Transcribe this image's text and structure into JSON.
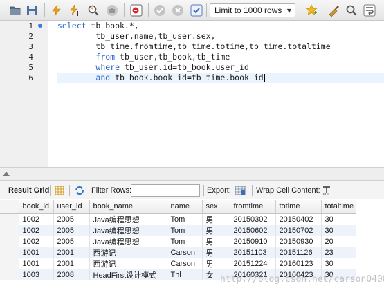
{
  "toolbar": {
    "buttons": [
      {
        "id": "open-folder",
        "icon": "folder-icon"
      },
      {
        "id": "save",
        "icon": "save-icon"
      },
      {
        "id": "execute",
        "icon": "lightning-icon"
      },
      {
        "id": "execute-current",
        "icon": "lightning-cursor-icon"
      },
      {
        "id": "explain",
        "icon": "magnifier-icon"
      },
      {
        "id": "stop",
        "icon": "stop-hand-icon"
      },
      {
        "id": "toggle-continue",
        "icon": "continue-on-error-icon"
      },
      {
        "id": "commit",
        "icon": "check-circle-icon"
      },
      {
        "id": "rollback",
        "icon": "cancel-circle-icon"
      },
      {
        "id": "autocommit",
        "icon": "autocommit-icon"
      }
    ],
    "limit_label": "Limit to 1000 rows",
    "right_buttons": [
      "star-icon",
      "broom-icon",
      "search-icon",
      "wrap-icon"
    ]
  },
  "editor": {
    "line_numbers": [
      "1",
      "2",
      "3",
      "4",
      "5",
      "6"
    ],
    "lines": [
      [
        {
          "t": "select",
          "k": true
        },
        {
          "t": " tb_book.*,",
          "k": false
        }
      ],
      [
        {
          "t": "        tb_user.name,tb_user.sex,",
          "k": false
        }
      ],
      [
        {
          "t": "        tb_time.fromtime,tb_time.totime,tb_time.totaltime",
          "k": false
        }
      ],
      [
        {
          "t": "        ",
          "k": false
        },
        {
          "t": "from",
          "k": true
        },
        {
          "t": " tb_user,tb_book,tb_time",
          "k": false
        }
      ],
      [
        {
          "t": "        ",
          "k": false
        },
        {
          "t": "where",
          "k": true
        },
        {
          "t": " tb_user.id=tb_book.user_id",
          "k": false
        }
      ],
      [
        {
          "t": "        ",
          "k": false
        },
        {
          "t": "and",
          "k": true
        },
        {
          "t": " tb_book.book_id=tb_time.book_id",
          "k": false
        }
      ]
    ],
    "current_line": 5
  },
  "result_toolbar": {
    "result_grid_label": "Result Grid",
    "filter_rows_label": "Filter Rows:",
    "filter_value": "",
    "export_label": "Export:",
    "wrap_label": "Wrap Cell Content:"
  },
  "grid": {
    "columns": [
      "book_id",
      "user_id",
      "book_name",
      "name",
      "sex",
      "fromtime",
      "totime",
      "totaltime"
    ],
    "rows": [
      [
        "1002",
        "2005",
        "Java编程思想",
        "Tom",
        "男",
        "20150302",
        "20150402",
        "30"
      ],
      [
        "1002",
        "2005",
        "Java编程思想",
        "Tom",
        "男",
        "20150602",
        "20150702",
        "30"
      ],
      [
        "1002",
        "2005",
        "Java编程思想",
        "Tom",
        "男",
        "20150910",
        "20150930",
        "20"
      ],
      [
        "1001",
        "2001",
        "西游记",
        "Carson",
        "男",
        "20151103",
        "20151126",
        "23"
      ],
      [
        "1001",
        "2001",
        "西游记",
        "Carson",
        "男",
        "20151224",
        "20160123",
        "30"
      ],
      [
        "1003",
        "2008",
        "HeadFirst设计模式",
        "Thl",
        "女",
        "20160321",
        "20160423",
        "30"
      ]
    ]
  },
  "watermark": "http://blog.csdn.net/carson0408",
  "colors": {
    "keyword": "#2c64c8",
    "current_line": "#eaf4ff",
    "alt_row": "#eef3fb"
  }
}
